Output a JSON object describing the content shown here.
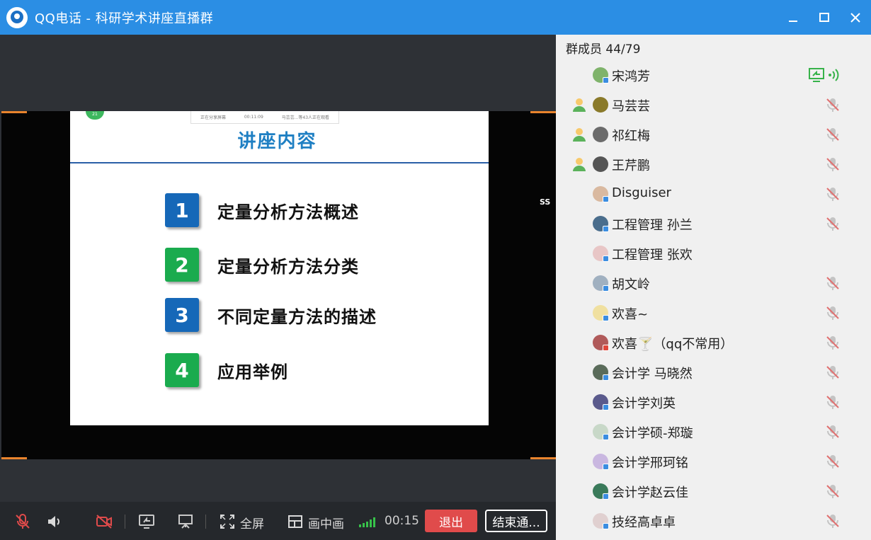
{
  "window": {
    "title": "QQ电话 - 科研学术讲座直播群"
  },
  "slide": {
    "header_strip": [
      "正在分享屏幕",
      "00:11:09",
      "马芸芸...等43人正在观看"
    ],
    "badge": "21",
    "title": "讲座内容",
    "items": [
      {
        "num": "1",
        "text": "定量分析方法概述",
        "color": "blue"
      },
      {
        "num": "2",
        "text": "定量分析方法分类",
        "color": "green"
      },
      {
        "num": "3",
        "text": "不同定量方法的描述",
        "color": "blue"
      },
      {
        "num": "4",
        "text": "应用举例",
        "color": "green"
      }
    ],
    "side_mark": "SS"
  },
  "toolbar": {
    "fullscreen_label": "全屏",
    "pip_label": "画中画",
    "timer": "00:15",
    "exit_label": "退出",
    "end_label": "结束通..."
  },
  "panel": {
    "header": "群成员 44/79",
    "members": [
      {
        "name": "宋鸿芳",
        "role": false,
        "status": "sharing",
        "dot": "blue"
      },
      {
        "name": "马芸芸",
        "role": true,
        "status": "muted",
        "dot": "none"
      },
      {
        "name": "祁红梅",
        "role": true,
        "status": "muted",
        "dot": "none"
      },
      {
        "name": "王芹鹏",
        "role": true,
        "status": "muted",
        "dot": "none"
      },
      {
        "name": "Disguiser",
        "role": false,
        "status": "muted",
        "dot": "blue"
      },
      {
        "name": "工程管理  孙兰",
        "role": false,
        "status": "muted",
        "dot": "blue"
      },
      {
        "name": "工程管理 张欢",
        "role": false,
        "status": "none",
        "dot": "blue"
      },
      {
        "name": "胡文岭",
        "role": false,
        "status": "muted",
        "dot": "blue"
      },
      {
        "name": "欢喜~",
        "role": false,
        "status": "muted",
        "dot": "blue"
      },
      {
        "name": "欢喜🍸（qq不常用）",
        "role": false,
        "status": "muted",
        "dot": "red"
      },
      {
        "name": "会计学 马晓然",
        "role": false,
        "status": "muted",
        "dot": "blue"
      },
      {
        "name": "会计学刘英",
        "role": false,
        "status": "muted",
        "dot": "blue"
      },
      {
        "name": "会计学硕-郑璇",
        "role": false,
        "status": "muted",
        "dot": "blue"
      },
      {
        "name": "会计学邢珂铭",
        "role": false,
        "status": "muted",
        "dot": "blue"
      },
      {
        "name": "会计学赵云佳",
        "role": false,
        "status": "muted",
        "dot": "blue"
      },
      {
        "name": "技经高卓卓",
        "role": false,
        "status": "muted",
        "dot": "blue"
      }
    ]
  },
  "colors": {
    "titlebar": "#2b8ee4",
    "exit": "#e04b4b",
    "signal": "#37c24a",
    "accent_orange": "#e9842d"
  },
  "icons": {
    "titlebar": [
      "qq-phone-logo",
      "minimize-icon",
      "maximize-icon",
      "close-icon"
    ],
    "toolbar": [
      "mic-off-icon",
      "speaker-icon",
      "camera-off-icon",
      "screen-share-icon",
      "presentation-icon",
      "fullscreen-icon",
      "pip-icon",
      "signal-icon"
    ],
    "member": [
      "role-user-icon",
      "mic-off-icon",
      "sharing-icon",
      "speaking-icon"
    ]
  }
}
